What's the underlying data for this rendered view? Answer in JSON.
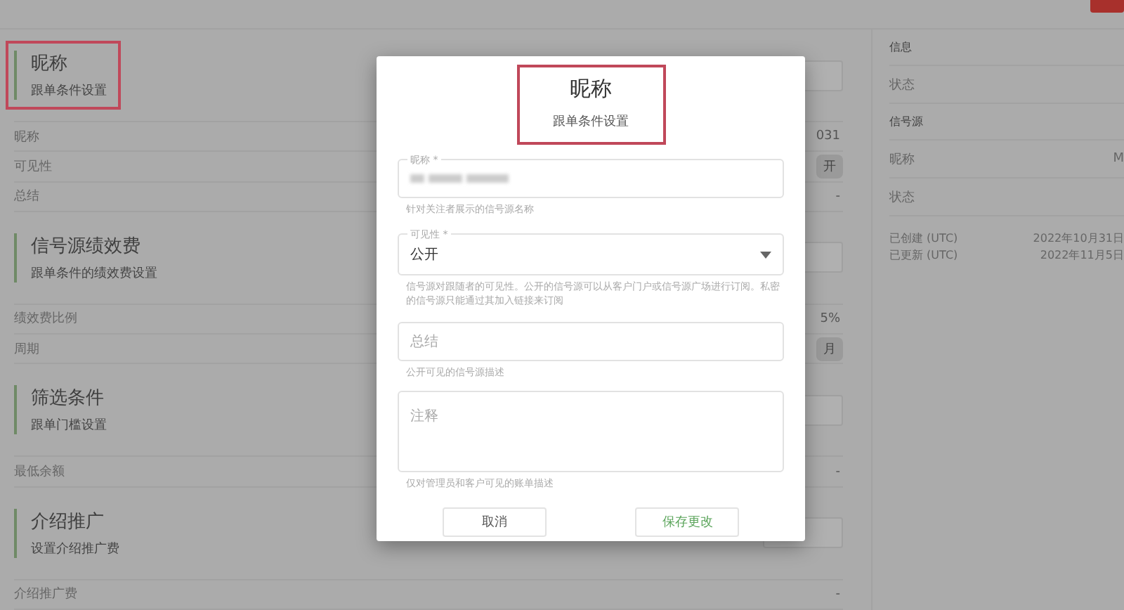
{
  "sections": [
    {
      "title": "昵称",
      "subtitle": "跟单条件设置",
      "highlighted": true,
      "rows": [
        {
          "label": "昵称",
          "value": "031",
          "kind": "text"
        },
        {
          "label": "可见性",
          "value": "开",
          "kind": "pill"
        },
        {
          "label": "总结",
          "value": "-",
          "kind": "text"
        }
      ]
    },
    {
      "title": "信号源绩效费",
      "subtitle": "跟单条件的绩效费设置",
      "highlighted": false,
      "rows": [
        {
          "label": "绩效费比例",
          "value": "5%",
          "kind": "text"
        },
        {
          "label": "周期",
          "value": "月",
          "kind": "pill"
        }
      ]
    },
    {
      "title": "筛选条件",
      "subtitle": "跟单门槛设置",
      "highlighted": false,
      "rows": [
        {
          "label": "最低余额",
          "value": "-",
          "kind": "text"
        }
      ]
    },
    {
      "title": "介绍推广",
      "subtitle": "设置介绍推广费",
      "highlighted": false,
      "rows": [
        {
          "label": "介绍推广费",
          "value": "-",
          "kind": "text"
        }
      ]
    }
  ],
  "info_panel": {
    "groups": [
      {
        "title": "信息",
        "rows": [
          {
            "label": "状态",
            "value": ""
          }
        ]
      },
      {
        "title": "信号源",
        "rows": [
          {
            "label": "昵称",
            "value": "M"
          },
          {
            "label": "状态",
            "value": ""
          }
        ]
      }
    ],
    "timestamps": [
      {
        "label": "已创建 (UTC)",
        "value": "2022年10月31日"
      },
      {
        "label": "已更新 (UTC)",
        "value": "2022年11月5日"
      }
    ]
  },
  "dialog": {
    "title": "昵称",
    "subtitle": "跟单条件设置",
    "highlighted": true,
    "fields": [
      {
        "kind": "input",
        "label": "昵称 *",
        "redacted": true,
        "helper": "针对关注者展示的信号源名称"
      },
      {
        "kind": "select",
        "label": "可见性 *",
        "value": "公开",
        "helper": "信号源对跟随者的可见性。公开的信号源可以从客户门户或信号源广场进行订阅。私密的信号源只能通过其加入链接来订阅"
      },
      {
        "kind": "input",
        "placeholder": "总结",
        "helper": "公开可见的信号源描述"
      },
      {
        "kind": "textarea",
        "placeholder": "注释",
        "helper": "仅对管理员和客户可见的账单描述"
      }
    ],
    "buttons": [
      {
        "label": "取消",
        "kind": "secondary"
      },
      {
        "label": "保存更改",
        "kind": "primary"
      }
    ]
  }
}
